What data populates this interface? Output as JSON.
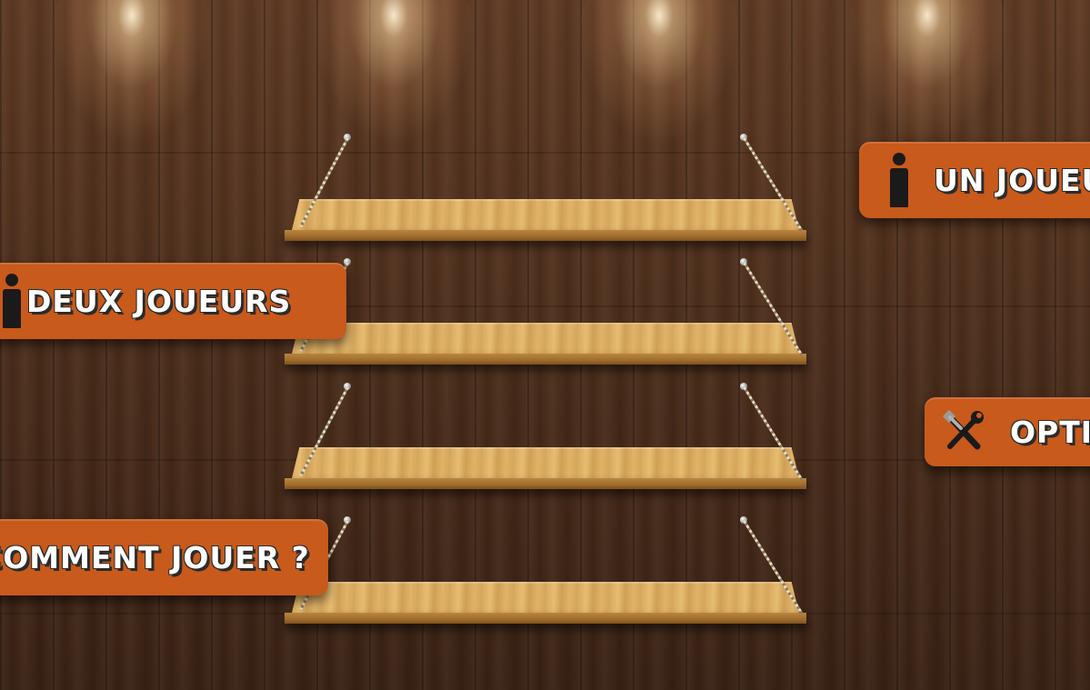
{
  "menu": {
    "one_player": {
      "label": "UN JOUEUR",
      "icon": "person-icon"
    },
    "two_players": {
      "label": "DEUX JOUEURS",
      "icon": "person-icon"
    },
    "options": {
      "label": "OPTIONS",
      "icon": "tools-icon"
    },
    "how_to_play": {
      "label": "COMMENT JOUER ?"
    }
  },
  "colors": {
    "button_orange": "#c85a1b",
    "label_white": "#ffffff",
    "wood_dark": "#4a2c1a",
    "shelf_wood": "#d9aa5f"
  }
}
